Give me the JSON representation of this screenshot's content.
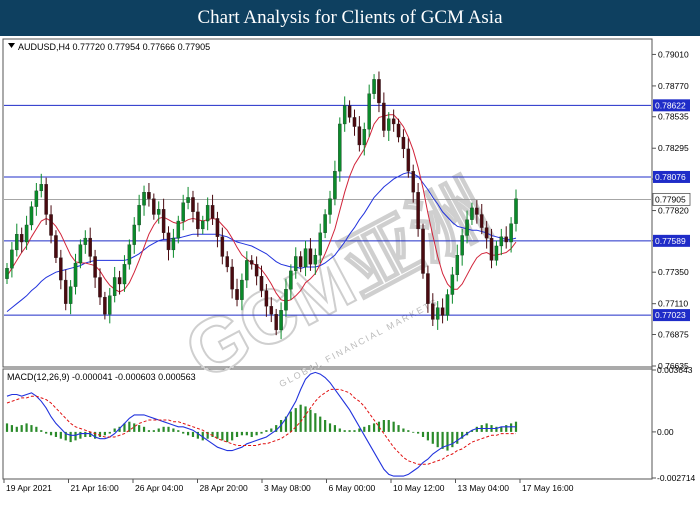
{
  "header": {
    "title": "Chart Analysis for Clients of GCM Asia"
  },
  "watermark": {
    "text": "GCM亚洲",
    "subtext": "GLOBAL FINANCIAL MARKETS"
  },
  "chart_data": [
    {
      "type": "candlestick",
      "title": "AUDUSD,H4 0.77720 0.77954 0.77666 0.77905",
      "symbol": "AUDUSD",
      "timeframe": "H4",
      "ohlc_last": {
        "open": 0.7772,
        "high": 0.77954,
        "low": 0.77666,
        "close": 0.77905
      },
      "ylim": [
        0.76635,
        0.7912
      ],
      "yticks": [
        "0.79010",
        "0.78770",
        "0.78535",
        "0.78295",
        "0.78060",
        "0.77820",
        "0.77590",
        "0.77350",
        "0.77110",
        "0.76875",
        "0.76635"
      ],
      "xticks": [
        "19 Apr 2021",
        "21 Apr 16:00",
        "26 Apr 04:00",
        "28 Apr 20:00",
        "3 May 08:00",
        "6 May 00:00",
        "10 May 12:00",
        "13 May 04:00",
        "17 May 16:00"
      ],
      "levels": [
        {
          "value": 0.78622,
          "label": "0.78622",
          "color": "#1f2cc8"
        },
        {
          "value": 0.78076,
          "label": "0.78076",
          "color": "#1f2cc8"
        },
        {
          "value": 0.77589,
          "label": "0.77589",
          "color": "#1f2cc8"
        },
        {
          "value": 0.77023,
          "label": "0.77023",
          "color": "#1f2cc8"
        }
      ],
      "current_price": {
        "value": 0.77905,
        "label": "0.77905"
      },
      "colors": {
        "up": "#0a8a2a",
        "down": "#4a0a10",
        "ma_fast": "#d1243a",
        "ma_slow": "#2233dd",
        "level_line": "#1f2cc8",
        "label_bg": "#1f2cc8"
      },
      "closes": [
        0.7738,
        0.7752,
        0.7764,
        0.7758,
        0.7771,
        0.7785,
        0.7797,
        0.7802,
        0.7779,
        0.7763,
        0.7746,
        0.7729,
        0.7711,
        0.7724,
        0.7742,
        0.7756,
        0.7761,
        0.7747,
        0.7731,
        0.7716,
        0.7703,
        0.7717,
        0.7731,
        0.7726,
        0.7741,
        0.7756,
        0.7771,
        0.7786,
        0.7796,
        0.7791,
        0.7779,
        0.7783,
        0.7765,
        0.7752,
        0.7761,
        0.7774,
        0.7788,
        0.7792,
        0.7781,
        0.7768,
        0.7774,
        0.7786,
        0.7776,
        0.7762,
        0.7747,
        0.7739,
        0.7722,
        0.7714,
        0.7729,
        0.7744,
        0.7741,
        0.7732,
        0.7721,
        0.7709,
        0.7703,
        0.7691,
        0.7706,
        0.7722,
        0.7736,
        0.7747,
        0.7739,
        0.7753,
        0.7741,
        0.7748,
        0.7765,
        0.7779,
        0.7791,
        0.7812,
        0.7848,
        0.7862,
        0.7853,
        0.7846,
        0.7832,
        0.7844,
        0.7871,
        0.7882,
        0.7864,
        0.7843,
        0.7852,
        0.7848,
        0.7838,
        0.7829,
        0.7812,
        0.7796,
        0.7768,
        0.7734,
        0.7711,
        0.7699,
        0.7708,
        0.7702,
        0.7718,
        0.7733,
        0.7748,
        0.7763,
        0.7775,
        0.7784,
        0.7779,
        0.7769,
        0.7761,
        0.7744,
        0.7755,
        0.7762,
        0.7758,
        0.7772,
        0.7791
      ],
      "ma_fast": [
        0.7732,
        0.7738,
        0.7744,
        0.775,
        0.7755,
        0.7762,
        0.7768,
        0.7774,
        0.7776,
        0.7774,
        0.777,
        0.7764,
        0.7756,
        0.7748,
        0.7743,
        0.7742,
        0.7742,
        0.7741,
        0.774,
        0.7736,
        0.773,
        0.7725,
        0.7722,
        0.772,
        0.7722,
        0.7727,
        0.7735,
        0.7744,
        0.7754,
        0.7764,
        0.7771,
        0.7776,
        0.7777,
        0.7775,
        0.7773,
        0.7772,
        0.7773,
        0.7775,
        0.7776,
        0.7775,
        0.7774,
        0.7775,
        0.7776,
        0.7775,
        0.7771,
        0.7767,
        0.7761,
        0.7754,
        0.7748,
        0.7745,
        0.7742,
        0.774,
        0.7737,
        0.7732,
        0.7726,
        0.7719,
        0.7714,
        0.7713,
        0.7714,
        0.7717,
        0.7721,
        0.7727,
        0.773,
        0.7734,
        0.7741,
        0.7749,
        0.7758,
        0.7768,
        0.7782,
        0.7796,
        0.7808,
        0.7817,
        0.7823,
        0.7829,
        0.7838,
        0.7848,
        0.7853,
        0.7854,
        0.7855,
        0.7855,
        0.7851,
        0.7846,
        0.7838,
        0.7828,
        0.7815,
        0.7799,
        0.778,
        0.7763,
        0.7747,
        0.7734,
        0.7726,
        0.7722,
        0.7722,
        0.7726,
        0.7733,
        0.774,
        0.7746,
        0.7749,
        0.775,
        0.7748,
        0.7748,
        0.7749,
        0.775,
        0.7753,
        0.7758
      ],
      "ma_slow": [
        0.7705,
        0.7708,
        0.7711,
        0.7714,
        0.7717,
        0.7721,
        0.7724,
        0.7728,
        0.7731,
        0.7733,
        0.7735,
        0.7736,
        0.7737,
        0.7738,
        0.7739,
        0.774,
        0.7742,
        0.7743,
        0.7744,
        0.7744,
        0.7744,
        0.7744,
        0.7744,
        0.7744,
        0.7744,
        0.7745,
        0.7747,
        0.7749,
        0.7752,
        0.7755,
        0.7757,
        0.7759,
        0.776,
        0.776,
        0.7761,
        0.7761,
        0.7762,
        0.7763,
        0.7764,
        0.7764,
        0.7764,
        0.7764,
        0.7764,
        0.7764,
        0.7763,
        0.7762,
        0.776,
        0.7758,
        0.7757,
        0.7756,
        0.7755,
        0.7753,
        0.7751,
        0.7749,
        0.7746,
        0.7743,
        0.7741,
        0.774,
        0.7739,
        0.7739,
        0.7738,
        0.7739,
        0.7739,
        0.7739,
        0.774,
        0.7742,
        0.7745,
        0.7748,
        0.7753,
        0.7758,
        0.7764,
        0.7769,
        0.7775,
        0.778,
        0.7786,
        0.7792,
        0.7796,
        0.78,
        0.7803,
        0.7806,
        0.7808,
        0.781,
        0.7811,
        0.781,
        0.7808,
        0.7803,
        0.7798,
        0.7792,
        0.7787,
        0.7781,
        0.7777,
        0.7773,
        0.777,
        0.7769,
        0.7768,
        0.7767,
        0.7767,
        0.7766,
        0.7765,
        0.7763,
        0.7762,
        0.7761,
        0.776,
        0.776,
        0.7761
      ]
    },
    {
      "type": "bar",
      "title": "MACD(12,26,9) -0.000041 -0.000603 0.000563",
      "indicator": "MACD(12,26,9)",
      "readout": [
        -4.1e-05,
        -0.000603,
        0.000563
      ],
      "ylim": [
        -0.002714,
        0.003643
      ],
      "yticks": [
        "0.003643",
        "0.00",
        "-0.002714"
      ],
      "colors": {
        "histogram": "#2a8a2a",
        "macd": "#2233dd",
        "signal": "#e01010"
      },
      "histogram": [
        0.0005,
        0.0004,
        0.0003,
        0.0004,
        0.0005,
        0.0004,
        0.0003,
        0.0001,
        -0.0001,
        -0.0002,
        -0.0003,
        -0.0004,
        -0.0005,
        -0.0006,
        -0.0005,
        -0.0004,
        -0.0003,
        -0.0003,
        -0.0004,
        -0.0003,
        -0.0002,
        -0.0001,
        0.0002,
        0.0003,
        0.0005,
        0.0006,
        0.0005,
        0.0004,
        0.0003,
        0.0001,
        0.0001,
        0.0002,
        0.0003,
        0.0003,
        0.0002,
        0.0001,
        -0.0001,
        -0.0002,
        -0.0003,
        -0.0004,
        -0.0005,
        -0.0004,
        -0.0003,
        -0.0004,
        -0.0005,
        -0.0006,
        -0.0005,
        -0.0003,
        -0.0002,
        -0.0002,
        -0.0003,
        -0.0002,
        -0.0001,
        0.0001,
        0.0002,
        0.0004,
        0.0007,
        0.0009,
        0.0012,
        0.0014,
        0.0016,
        0.0015,
        0.0013,
        0.0011,
        0.0009,
        0.0007,
        0.0005,
        0.0004,
        0.0002,
        0.0001,
        0.0001,
        0.0001,
        0.0002,
        0.0003,
        0.0004,
        0.0005,
        0.0006,
        0.0007,
        0.0007,
        0.0006,
        0.0004,
        0.0002,
        0.0001,
        0,
        -0.0001,
        -0.0003,
        -0.0005,
        -0.0007,
        -0.0009,
        -0.001,
        -0.0011,
        -0.0009,
        -0.0007,
        -0.0004,
        -0.0002,
        0.0001,
        0.0003,
        0.0004,
        0.0005,
        0.0004,
        0.0003,
        0.0003,
        0.0004,
        0.0005,
        0.0006
      ],
      "macd": [
        0.0021,
        0.0022,
        0.0022,
        0.0021,
        0.0022,
        0.0023,
        0.0021,
        0.0018,
        0.0014,
        0.0009,
        0.0005,
        0.0002,
        -0.0001,
        -0.0002,
        -0.0002,
        -0.0001,
        -0.0001,
        -0.0001,
        -0.0003,
        -0.0004,
        -0.0004,
        -0.0003,
        -0.0001,
        0.0002,
        0.0005,
        0.0008,
        0.001,
        0.001,
        0.001,
        0.0009,
        0.0008,
        0.0007,
        0.0006,
        0.0005,
        0.0004,
        0.0003,
        0.0003,
        0.0002,
        0.0001,
        -0.0001,
        -0.0003,
        -0.0005,
        -0.0007,
        -0.0009,
        -0.001,
        -0.0011,
        -0.0011,
        -0.001,
        -0.0009,
        -0.0007,
        -0.0006,
        -0.0005,
        -0.0004,
        -0.0003,
        -0.0001,
        0.0001,
        0.0004,
        0.0008,
        0.0013,
        0.0018,
        0.0025,
        0.0031,
        0.0034,
        0.0035,
        0.0034,
        0.0032,
        0.0029,
        0.0025,
        0.0021,
        0.0017,
        0.0013,
        0.0008,
        0.0003,
        -0.0002,
        -0.0007,
        -0.0012,
        -0.0017,
        -0.0022,
        -0.0025,
        -0.0026,
        -0.0026,
        -0.0026,
        -0.0025,
        -0.0023,
        -0.0021,
        -0.0018,
        -0.0016,
        -0.0013,
        -0.0011,
        -0.0009,
        -0.0008,
        -0.0007,
        -0.0005,
        -0.0003,
        -0.0001,
        0.0001,
        0.0002,
        0.0002,
        0.0002,
        0.0002,
        0.0002,
        0.0003,
        0.0003,
        0.0003,
        0.0003
      ],
      "signal": [
        0.0017,
        0.0018,
        0.0019,
        0.002,
        0.002,
        0.0021,
        0.0021,
        0.002,
        0.0019,
        0.0017,
        0.0014,
        0.0011,
        0.0008,
        0.0005,
        0.0003,
        0.0002,
        0.0001,
        0,
        -0.0001,
        -0.0002,
        -0.0003,
        -0.0003,
        -0.0003,
        -0.0002,
        -0.0001,
        0.0001,
        0.0003,
        0.0005,
        0.0006,
        0.0007,
        0.0007,
        0.0007,
        0.0007,
        0.0007,
        0.0006,
        0.0006,
        0.0005,
        0.0004,
        0.0003,
        0.0002,
        0.0001,
        -0.0001,
        -0.0002,
        -0.0004,
        -0.0005,
        -0.0006,
        -0.0007,
        -0.0008,
        -0.0008,
        -0.0008,
        -0.0008,
        -0.0008,
        -0.0007,
        -0.0007,
        -0.0006,
        -0.0005,
        -0.0004,
        -0.0002,
        0,
        0.0003,
        0.0006,
        0.001,
        0.0014,
        0.0018,
        0.0021,
        0.0023,
        0.0025,
        0.0025,
        0.0025,
        0.0024,
        0.0023,
        0.002,
        0.0018,
        0.0015,
        0.0011,
        0.0007,
        0.0003,
        -0.0001,
        -0.0005,
        -0.0009,
        -0.0012,
        -0.0015,
        -0.0017,
        -0.0018,
        -0.0019,
        -0.0019,
        -0.0019,
        -0.0018,
        -0.0017,
        -0.0016,
        -0.0014,
        -0.0013,
        -0.0011,
        -0.001,
        -0.0008,
        -0.0006,
        -0.0005,
        -0.0004,
        -0.0003,
        -0.0002,
        -0.0002,
        -0.0001,
        -0.0001,
        -0.0001,
        -0.0001
      ]
    }
  ]
}
